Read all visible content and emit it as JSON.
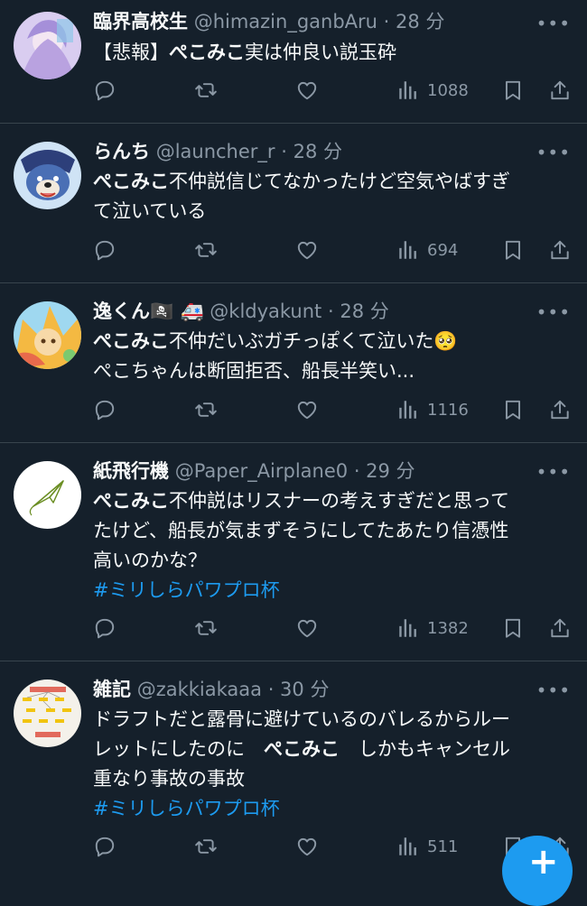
{
  "tweets": [
    {
      "name": "臨界高校生",
      "handle": "@himazin_ganbAru",
      "time": "· 28 分",
      "body": [
        [
          {
            "t": "【悲報】",
            "b": false
          },
          {
            "t": "ぺこみこ",
            "b": true
          },
          {
            "t": "実は仲良い説玉砕",
            "b": false
          }
        ]
      ],
      "hashtag": "",
      "views": "1088",
      "avatar_color": "#c9b6e8"
    },
    {
      "name": "らんち",
      "handle": "@launcher_r",
      "time": "· 28 分",
      "body": [
        [
          {
            "t": "ぺこみこ",
            "b": true
          },
          {
            "t": "不仲説信じてなかったけど空気やばすぎ",
            "b": false
          }
        ],
        [
          {
            "t": "て泣いている",
            "b": false
          }
        ]
      ],
      "hashtag": "",
      "views": "694",
      "avatar_color": "#3d5a9a"
    },
    {
      "name": "逸くん🏴‍☠️ 🚑",
      "handle": "@kldyakunt",
      "time": "· 28 分",
      "body": [
        [
          {
            "t": "ぺこみこ",
            "b": true
          },
          {
            "t": "不仲だいぶガチっぽくて泣いた🥺",
            "b": false
          }
        ],
        [
          {
            "t": "ぺこちゃんは断固拒否、船長半笑い...",
            "b": false
          }
        ]
      ],
      "hashtag": "",
      "views": "1116",
      "avatar_color": "#f2c14e"
    },
    {
      "name": "紙飛行機",
      "handle": "@Paper_Airplane0",
      "time": "· 29 分",
      "body": [
        [
          {
            "t": "ぺこみこ",
            "b": true
          },
          {
            "t": "不仲説はリスナーの考えすぎだと思って",
            "b": false
          }
        ],
        [
          {
            "t": "たけど、船長が気まずそうにしてたあたり信憑性",
            "b": false
          }
        ],
        [
          {
            "t": "高いのかな？",
            "b": false
          }
        ]
      ],
      "hashtag": "#ミリしらパワプロ杯",
      "views": "1382",
      "avatar_color": "#ffffff"
    },
    {
      "name": "雑記",
      "handle": "@zakkiakaaa",
      "time": "· 30 分",
      "body": [
        [
          {
            "t": "ドラフトだと露骨に避けているのバレるからルー",
            "b": false
          }
        ],
        [
          {
            "t": "レットにしたのに　",
            "b": false
          },
          {
            "t": "ぺこみこ",
            "b": true
          },
          {
            "t": "　しかもキャンセル",
            "b": false
          }
        ],
        [
          {
            "t": "重なり事故の事故",
            "b": false
          }
        ]
      ],
      "hashtag": "#ミリしらパワプロ杯",
      "views": "511",
      "avatar_color": "#f4f1ea"
    }
  ],
  "icons": {
    "more": "more-icon",
    "reply": "reply-icon",
    "retweet": "retweet-icon",
    "like": "heart-icon",
    "views": "views-icon",
    "bookmark": "bookmark-icon",
    "share": "share-icon",
    "compose": "compose-plus-icon"
  },
  "colors": {
    "background": "#15202b",
    "text": "#f7f9f9",
    "muted": "#8b98a5",
    "accent": "#1d9bf0"
  },
  "compose_glyph": "+"
}
